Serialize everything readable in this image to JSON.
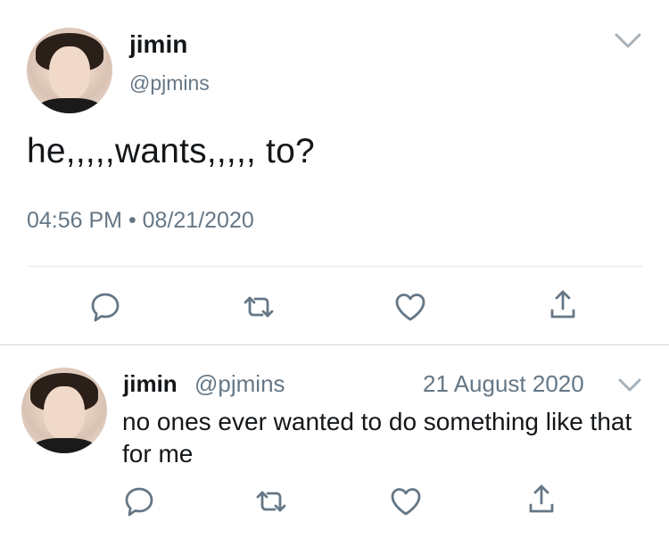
{
  "main_tweet": {
    "display_name": "jimin",
    "handle": "@pjmins",
    "text": "he,,,,,wants,,,,, to?",
    "timestamp": "04:56 PM • 08/21/2020",
    "icons": {
      "menu": "chevron-down-icon",
      "reply": "reply-icon",
      "retweet": "retweet-icon",
      "like": "heart-icon",
      "share": "share-icon"
    }
  },
  "reply_tweet": {
    "display_name": "jimin",
    "handle": "@pjmins",
    "date": "21 August 2020",
    "text": "no ones ever wanted to do something like that for me",
    "icons": {
      "menu": "chevron-down-icon",
      "reply": "reply-icon",
      "retweet": "retweet-icon",
      "like": "heart-icon",
      "share": "share-icon"
    }
  },
  "colors": {
    "primary_text": "#14171a",
    "secondary_text": "#657786",
    "icon": "#657786",
    "divider": "#e1e8ed"
  }
}
